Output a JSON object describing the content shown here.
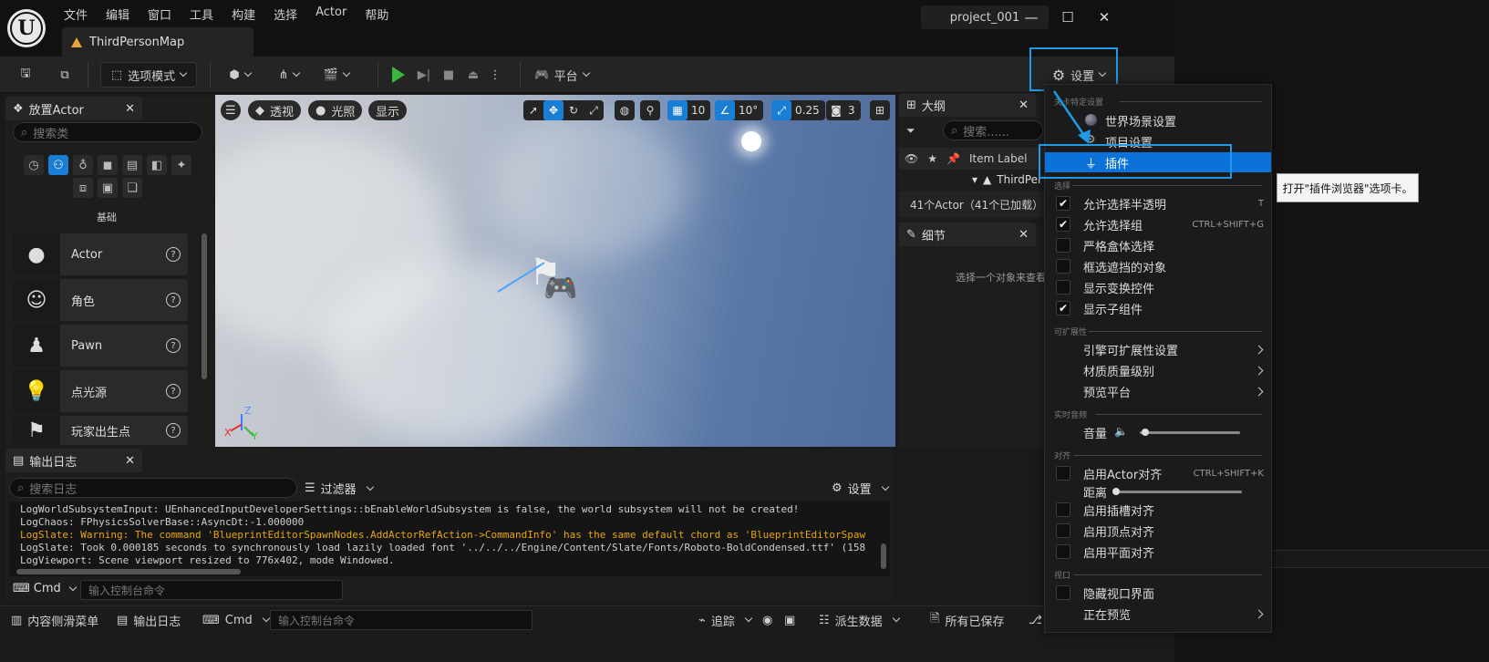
{
  "app": {
    "menus": [
      "文件",
      "编辑",
      "窗口",
      "工具",
      "构建",
      "选择",
      "Actor",
      "帮助"
    ],
    "map_tab": "ThirdPersonMap",
    "project": "project_001"
  },
  "toolbar": {
    "mode": "选项模式",
    "platform": "平台",
    "settings": "设置"
  },
  "place_actor": {
    "title": "放置Actor",
    "search_placeholder": "搜索类",
    "category": "基础",
    "items": [
      "Actor",
      "角色",
      "Pawn",
      "点光源",
      "玩家出生点"
    ]
  },
  "viewport": {
    "perspective": "透视",
    "lighting": "光照",
    "show": "显示",
    "grid": "10",
    "rotation": "10°",
    "scale": "0.25",
    "camera": "3"
  },
  "outliner": {
    "title": "大纲",
    "search_placeholder": "搜索......",
    "column": "Item Label",
    "row": "ThirdPer",
    "count": "41个Actor（41个已加载）"
  },
  "details": {
    "title": "细节",
    "hint": "选择一个对象来查看"
  },
  "output_log": {
    "title": "输出日志",
    "search_placeholder": "搜索日志",
    "filter": "过滤器",
    "settings": "设置",
    "lines": [
      {
        "text": "LogWorldSubsystemInput: UEnhancedInputDeveloperSettings::bEnableWorldSubsystem is false, the world subsystem will not be created!",
        "level": "info"
      },
      {
        "text": "LogChaos: FPhysicsSolverBase::AsyncDt:-1.000000",
        "level": "info"
      },
      {
        "text": "LogSlate: Warning: The command 'BlueprintEditorSpawnNodes.AddActorRefAction->CommandInfo' has the same default chord as 'BlueprintEditorSpaw",
        "level": "warn"
      },
      {
        "text": "LogSlate: Took 0.000185 seconds to synchronously load lazily loaded font '../../../Engine/Content/Slate/Fonts/Roboto-BoldCondensed.ttf' (158",
        "level": "info"
      },
      {
        "text": "LogViewport: Scene viewport resized to 776x402, mode Windowed.",
        "level": "info"
      }
    ],
    "cmd": "Cmd",
    "cmd_placeholder": "输入控制台命令"
  },
  "statusbar": {
    "content_drawer": "内容侧滑菜单",
    "output_log": "输出日志",
    "cmd": "Cmd",
    "cmd_placeholder": "输入控制台命令",
    "trace": "追踪",
    "derived_data": "派生数据",
    "all_saved": "所有已保存"
  },
  "settings_menu": {
    "section_level": "关卡特定设置",
    "world_settings": "世界场景设置",
    "project_settings": "项目设置",
    "plugins": "插件",
    "section_select": "选择",
    "select_items": [
      {
        "label": "允许选择半透明",
        "shortcut": "T",
        "checked": true
      },
      {
        "label": "允许选择组",
        "shortcut": "CTRL+SHIFT+G",
        "checked": true
      },
      {
        "label": "严格盒体选择",
        "shortcut": "",
        "checked": false
      },
      {
        "label": "框选遮挡的对象",
        "shortcut": "",
        "checked": false
      },
      {
        "label": "显示变换控件",
        "shortcut": "",
        "checked": false
      },
      {
        "label": "显示子组件",
        "shortcut": "",
        "checked": true
      }
    ],
    "section_scalability": "可扩展性",
    "scalability_items": [
      "引擎可扩展性设置",
      "材质质量级别",
      "预览平台"
    ],
    "section_audio": "实时音频",
    "volume": "音量",
    "volume_level": 0.05,
    "section_snap": "对齐",
    "actor_snap": "启用Actor对齐",
    "actor_snap_shortcut": "CTRL+SHIFT+K",
    "distance": "距离",
    "socket_snap": "启用插槽对齐",
    "vertex_snap": "启用顶点对齐",
    "plane_snap": "启用平面对齐",
    "section_viewport": "视口",
    "hide_viewport_ui": "隐藏视口界面",
    "previewing": "正在预览"
  },
  "tooltip": "打开\"插件浏览器\"选项卡。",
  "colors": {
    "accent": "#1e9be8",
    "selection": "#0a72d8",
    "warning": "#e8a60f",
    "play": "#3cb53c"
  }
}
